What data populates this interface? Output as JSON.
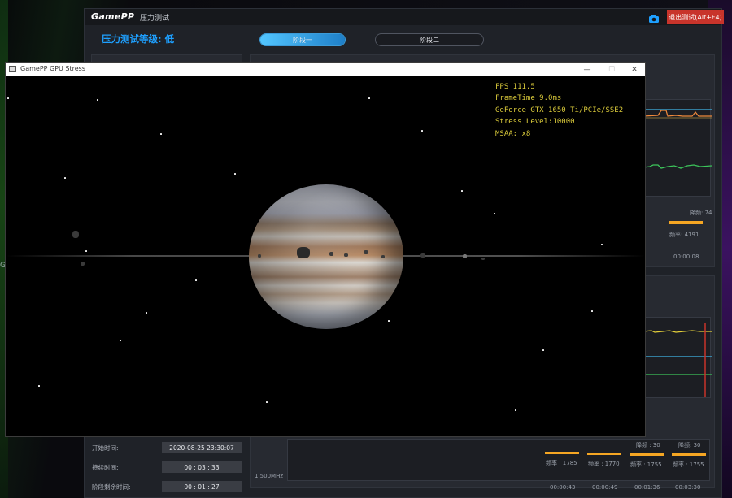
{
  "desktop": {
    "edge_glyph": "G"
  },
  "gamepp": {
    "logo": "GamePP",
    "app_title": "压力测试",
    "exit_button": "退出测试(Alt+F4)",
    "stress_level_label": "压力测试等级: 低",
    "stage_tabs": [
      {
        "label": "阶段一",
        "active": true
      },
      {
        "label": "阶段二",
        "active": false
      }
    ],
    "top_chart": {
      "drop_label": "降频: 74",
      "freq_label": "频率: 4191",
      "time": "00:00:08"
    },
    "bottom_chart": {
      "y_label": "1,500MHz",
      "drops": [
        {
          "freq": "频率 : 1785",
          "time": "00:00:43"
        },
        {
          "freq": "频率 : 1770",
          "time": "00:00:49"
        },
        {
          "drop": "降频 : 30",
          "freq": "频率 : 1755",
          "time": "00:01:36"
        },
        {
          "drop": "降频: 30",
          "freq": "频率 : 1755",
          "time": "00:03:30"
        }
      ]
    },
    "info": [
      {
        "key": "开始时间:",
        "value": "2020-08-25 23:30:07"
      },
      {
        "key": "持续时间:",
        "value": "00 : 03 : 33"
      },
      {
        "key": "阶段剩余时间:",
        "value": "00 : 01 : 27"
      }
    ],
    "accent_color": "#1ea0ff",
    "exit_color": "#c8342b",
    "bar_color": "#f5a623"
  },
  "stress_window": {
    "title": "GamePP GPU Stress",
    "controls": {
      "minimize": "—",
      "maximize": "☐",
      "close": "✕"
    },
    "hud": {
      "fps": "FPS 111.5",
      "frametime": "FrameTime 9.0ms",
      "gpu": "GeForce GTX 1650 Ti/PCIe/SSE2",
      "stress_level": "Stress Level:10000",
      "msaa": "MSAA: x8"
    },
    "hud_color": "#d9c93a"
  }
}
